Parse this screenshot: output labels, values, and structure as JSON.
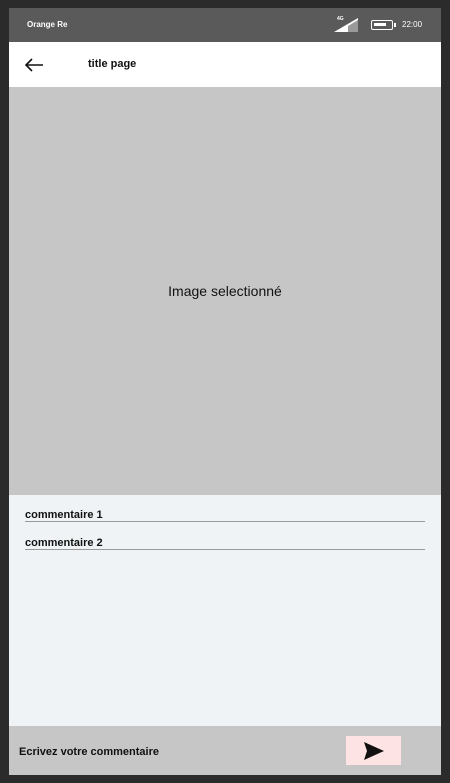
{
  "status_bar": {
    "carrier": "Orange Re",
    "network": "4G",
    "time": "22:00",
    "icons": [
      "signal-icon",
      "battery-icon"
    ]
  },
  "app_bar": {
    "back_icon": "arrow-left-icon",
    "title": "title page"
  },
  "image": {
    "label": "Image selectionné"
  },
  "comments": [
    {
      "text": "commentaire 1"
    },
    {
      "text": "commentaire 2"
    }
  ],
  "composer": {
    "placeholder": "Ecrivez votre commentaire",
    "send_icon": "send-icon",
    "send_color": "#fde3e3"
  },
  "colors": {
    "status_bar": "#5a5a5a",
    "image_bg": "#c6c6c6",
    "page_bg": "#eff3f6"
  }
}
